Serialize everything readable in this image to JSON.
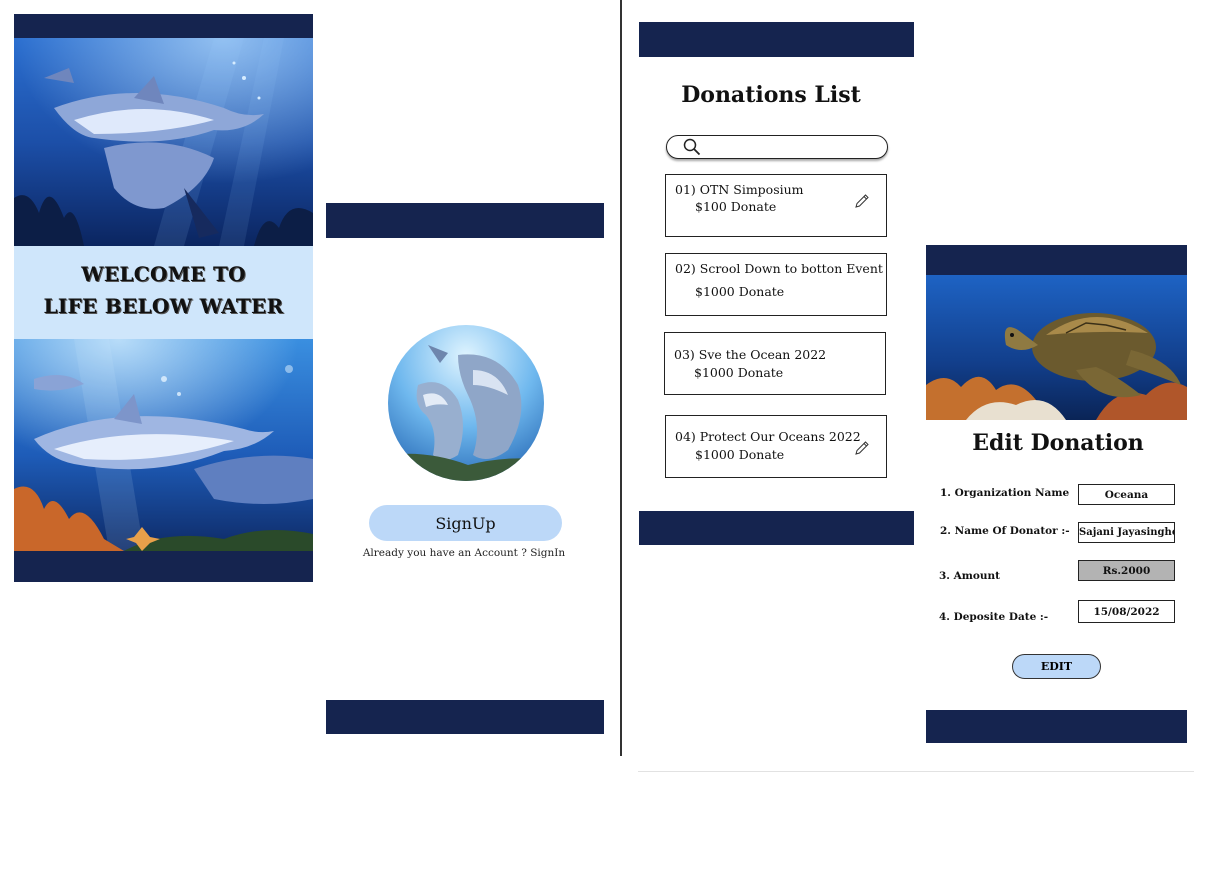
{
  "welcome_screen": {
    "line1": "WELCOME TO",
    "line2": "LIFE BELOW WATER"
  },
  "signup_screen": {
    "signup_label": "SignUp",
    "signin_prompt": "Already you have an Account ? SignIn"
  },
  "donations_screen": {
    "title": "Donations List",
    "search": {
      "value": "",
      "placeholder": ""
    },
    "items": [
      {
        "title": "01) OTN Simposium",
        "amount": "$100 Donate",
        "editable": true
      },
      {
        "title": "02) Scrool Down to botton Event",
        "amount": "$1000 Donate",
        "editable": false
      },
      {
        "title": "03) Sve the Ocean 2022",
        "amount": "$1000 Donate",
        "editable": false
      },
      {
        "title": "04) Protect Our Oceans 2022",
        "amount": "$1000 Donate",
        "editable": true
      }
    ]
  },
  "edit_screen": {
    "title": "Edit Donation",
    "fields": [
      {
        "label": "1. Organization Name",
        "value": "Oceana"
      },
      {
        "label": "2. Name Of Donator :-",
        "value": "Sajani Jayasinghe"
      },
      {
        "label": "3. Amount",
        "value": "Rs.2000"
      },
      {
        "label": "4. Deposite Date :-",
        "value": "15/08/2022"
      }
    ],
    "edit_label": "EDIT"
  },
  "colors": {
    "navy_bar": "#15244f",
    "button_blue": "#bcd8f8",
    "welcome_band": "#cfe6fb",
    "amount_field": "#b3b3b3"
  },
  "icons": [
    "search-icon",
    "pencil-icon"
  ]
}
